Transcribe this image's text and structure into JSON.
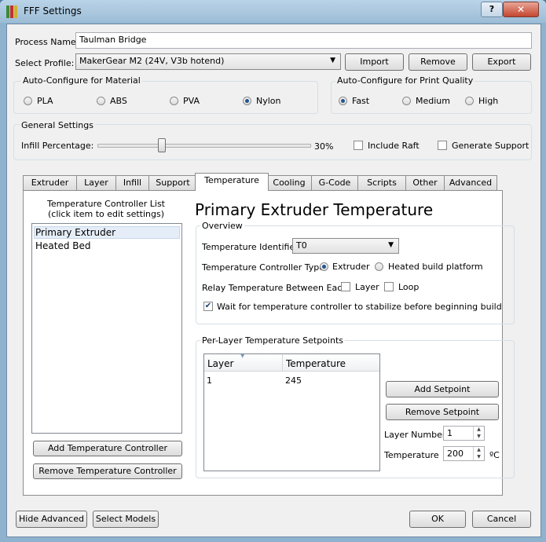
{
  "window": {
    "title": "FFF Settings",
    "help_label": "?",
    "close_label": "✕"
  },
  "process": {
    "label": "Process Name:",
    "value": "Taulman Bridge"
  },
  "profile": {
    "label": "Select Profile:",
    "selected": "MakerGear M2 (24V, V3b hotend)",
    "import_label": "Import",
    "remove_label": "Remove",
    "export_label": "Export"
  },
  "material": {
    "title": "Auto-Configure for Material",
    "options": [
      "PLA",
      "ABS",
      "PVA",
      "Nylon"
    ],
    "selected": "Nylon"
  },
  "quality": {
    "title": "Auto-Configure for Print Quality",
    "options": [
      "Fast",
      "Medium",
      "High"
    ],
    "selected": "Fast"
  },
  "general": {
    "title": "General Settings",
    "infill_label": "Infill Percentage:",
    "infill_value_text": "30%",
    "infill_fraction": 0.3,
    "raft_label": "Include Raft",
    "raft_checked": false,
    "support_label": "Generate Support",
    "support_checked": false
  },
  "tabs": [
    "Extruder",
    "Layer",
    "Infill",
    "Support",
    "Temperature",
    "Cooling",
    "G-Code",
    "Scripts",
    "Other",
    "Advanced"
  ],
  "active_tab": "Temperature",
  "controllers": {
    "heading_line1": "Temperature Controller List",
    "heading_line2": "(click item to edit settings)",
    "items": [
      "Primary Extruder",
      "Heated Bed"
    ],
    "selected": "Primary Extruder",
    "add_label": "Add Temperature Controller",
    "remove_label": "Remove Temperature Controller"
  },
  "detail": {
    "heading": "Primary Extruder Temperature",
    "overview_title": "Overview",
    "identifier_label": "Temperature Identifier",
    "identifier_value": "T0",
    "controller_type_label": "Temperature Controller Type:",
    "type_extruder": "Extruder",
    "type_platform": "Heated build platform",
    "type_selected": "Extruder",
    "relay_label": "Relay Temperature Between Each:",
    "relay_layer": "Layer",
    "relay_loop": "Loop",
    "wait_label": "Wait for temperature controller to stabilize before beginning build",
    "wait_checked": true
  },
  "setpoints": {
    "title": "Per-Layer Temperature Setpoints",
    "columns": [
      "Layer",
      "Temperature"
    ],
    "rows": [
      [
        "1",
        "245"
      ]
    ],
    "add_label": "Add Setpoint",
    "remove_label": "Remove Setpoint",
    "layer_number_label": "Layer Number",
    "layer_number_value": "1",
    "temperature_label": "Temperature",
    "temperature_value": "200",
    "unit": "ºC"
  },
  "footer": {
    "hide_advanced": "Hide Advanced",
    "select_models": "Select Models",
    "ok": "OK",
    "cancel": "Cancel"
  },
  "colors": {
    "accent": "#23558f",
    "title_bar": "#9dbdd6",
    "close": "#c4472f"
  }
}
